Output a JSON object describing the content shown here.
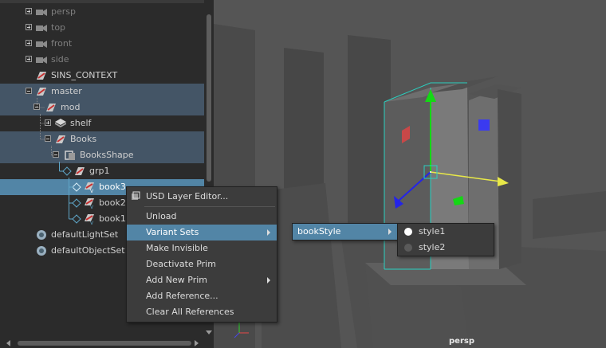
{
  "outliner": {
    "rows": [
      {
        "label": "persp",
        "icon": "camera-icon",
        "dim": true
      },
      {
        "label": "top",
        "icon": "camera-icon",
        "dim": true
      },
      {
        "label": "front",
        "icon": "camera-icon",
        "dim": true
      },
      {
        "label": "side",
        "icon": "camera-icon",
        "dim": true
      },
      {
        "label": "SINS_CONTEXT",
        "icon": "transform-icon"
      },
      {
        "label": "master",
        "icon": "transform-icon"
      },
      {
        "label": "mod",
        "icon": "transform-icon"
      },
      {
        "label": "shelf",
        "icon": "mesh-icon"
      },
      {
        "label": "Books",
        "icon": "transform-icon"
      },
      {
        "label": "BooksShape",
        "icon": "usd-proxy-shape-icon"
      },
      {
        "label": "grp1",
        "icon": "transform-icon"
      },
      {
        "label": "book3",
        "icon": "usd-prim-icon"
      },
      {
        "label": "book2",
        "icon": "usd-prim-icon"
      },
      {
        "label": "book1",
        "icon": "usd-prim-icon"
      },
      {
        "label": "defaultLightSet",
        "icon": "set-icon"
      },
      {
        "label": "defaultObjectSet",
        "icon": "set-icon"
      }
    ]
  },
  "context_menu": {
    "items": [
      {
        "label": "USD Layer Editor...",
        "icon": "usd-layer-editor-icon"
      },
      {
        "label": "Unload"
      },
      {
        "label": "Variant Sets",
        "submenu": true,
        "active": true
      },
      {
        "label": "Make Invisible"
      },
      {
        "label": "Deactivate Prim"
      },
      {
        "label": "Add New Prim",
        "submenu": true
      },
      {
        "label": "Add Reference..."
      },
      {
        "label": "Clear All References"
      }
    ]
  },
  "variant_sets_submenu": {
    "items": [
      {
        "label": "bookStyle",
        "active": true
      }
    ]
  },
  "book_style_submenu": {
    "items": [
      {
        "label": "style1",
        "selected": true
      },
      {
        "label": "style2",
        "selected": false
      }
    ]
  },
  "viewport": {
    "camera_label": "persp"
  },
  "colors": {
    "selection": "#5285a6",
    "highlight": "#445566",
    "menu_bg": "#3c3c3c",
    "outliner_bg": "#2b2b2b",
    "viewport_bg": "#555555"
  }
}
